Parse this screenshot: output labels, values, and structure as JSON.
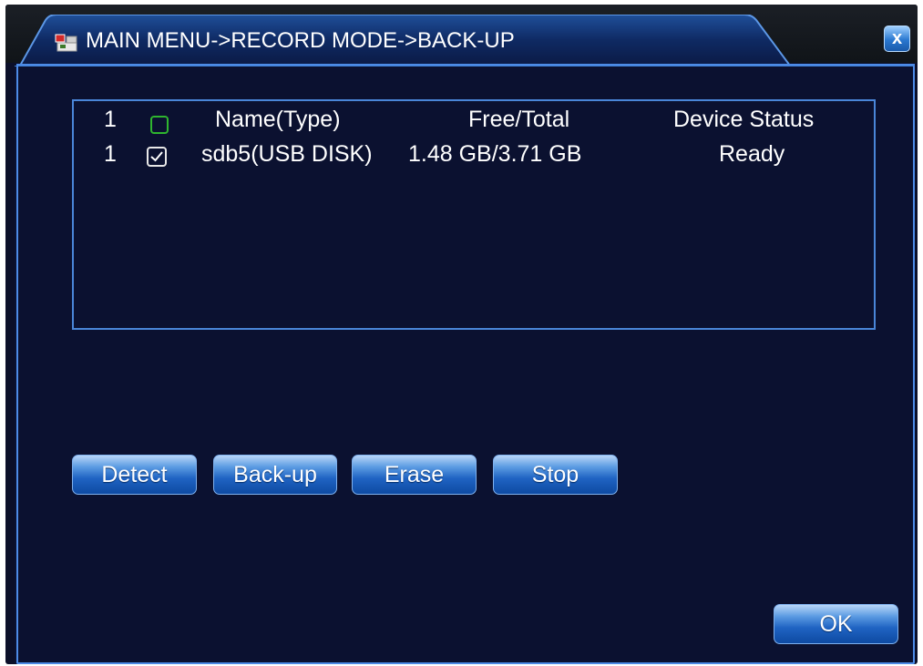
{
  "window": {
    "title": "MAIN MENU->RECORD MODE->BACK-UP",
    "title_icon": "menu-record-icon",
    "close_icon": "close-icon",
    "close_label": "x"
  },
  "colors": {
    "background": "#0b1130",
    "accent_border": "#4d8be6",
    "text": "#ffffff",
    "header_checkbox": "#2fb52f",
    "button_blue": "#1f63c2"
  },
  "device_table": {
    "header": {
      "index": "1",
      "name": "Name(Type)",
      "free_total": "Free/Total",
      "status": "Device Status"
    },
    "rows": [
      {
        "index": "1",
        "checked": true,
        "name": "sdb5(USB DISK)",
        "free_total": "1.48 GB/3.71 GB",
        "status": "Ready"
      }
    ]
  },
  "actions": {
    "detect": "Detect",
    "backup": "Back-up",
    "erase": "Erase",
    "stop": "Stop",
    "ok": "OK"
  }
}
